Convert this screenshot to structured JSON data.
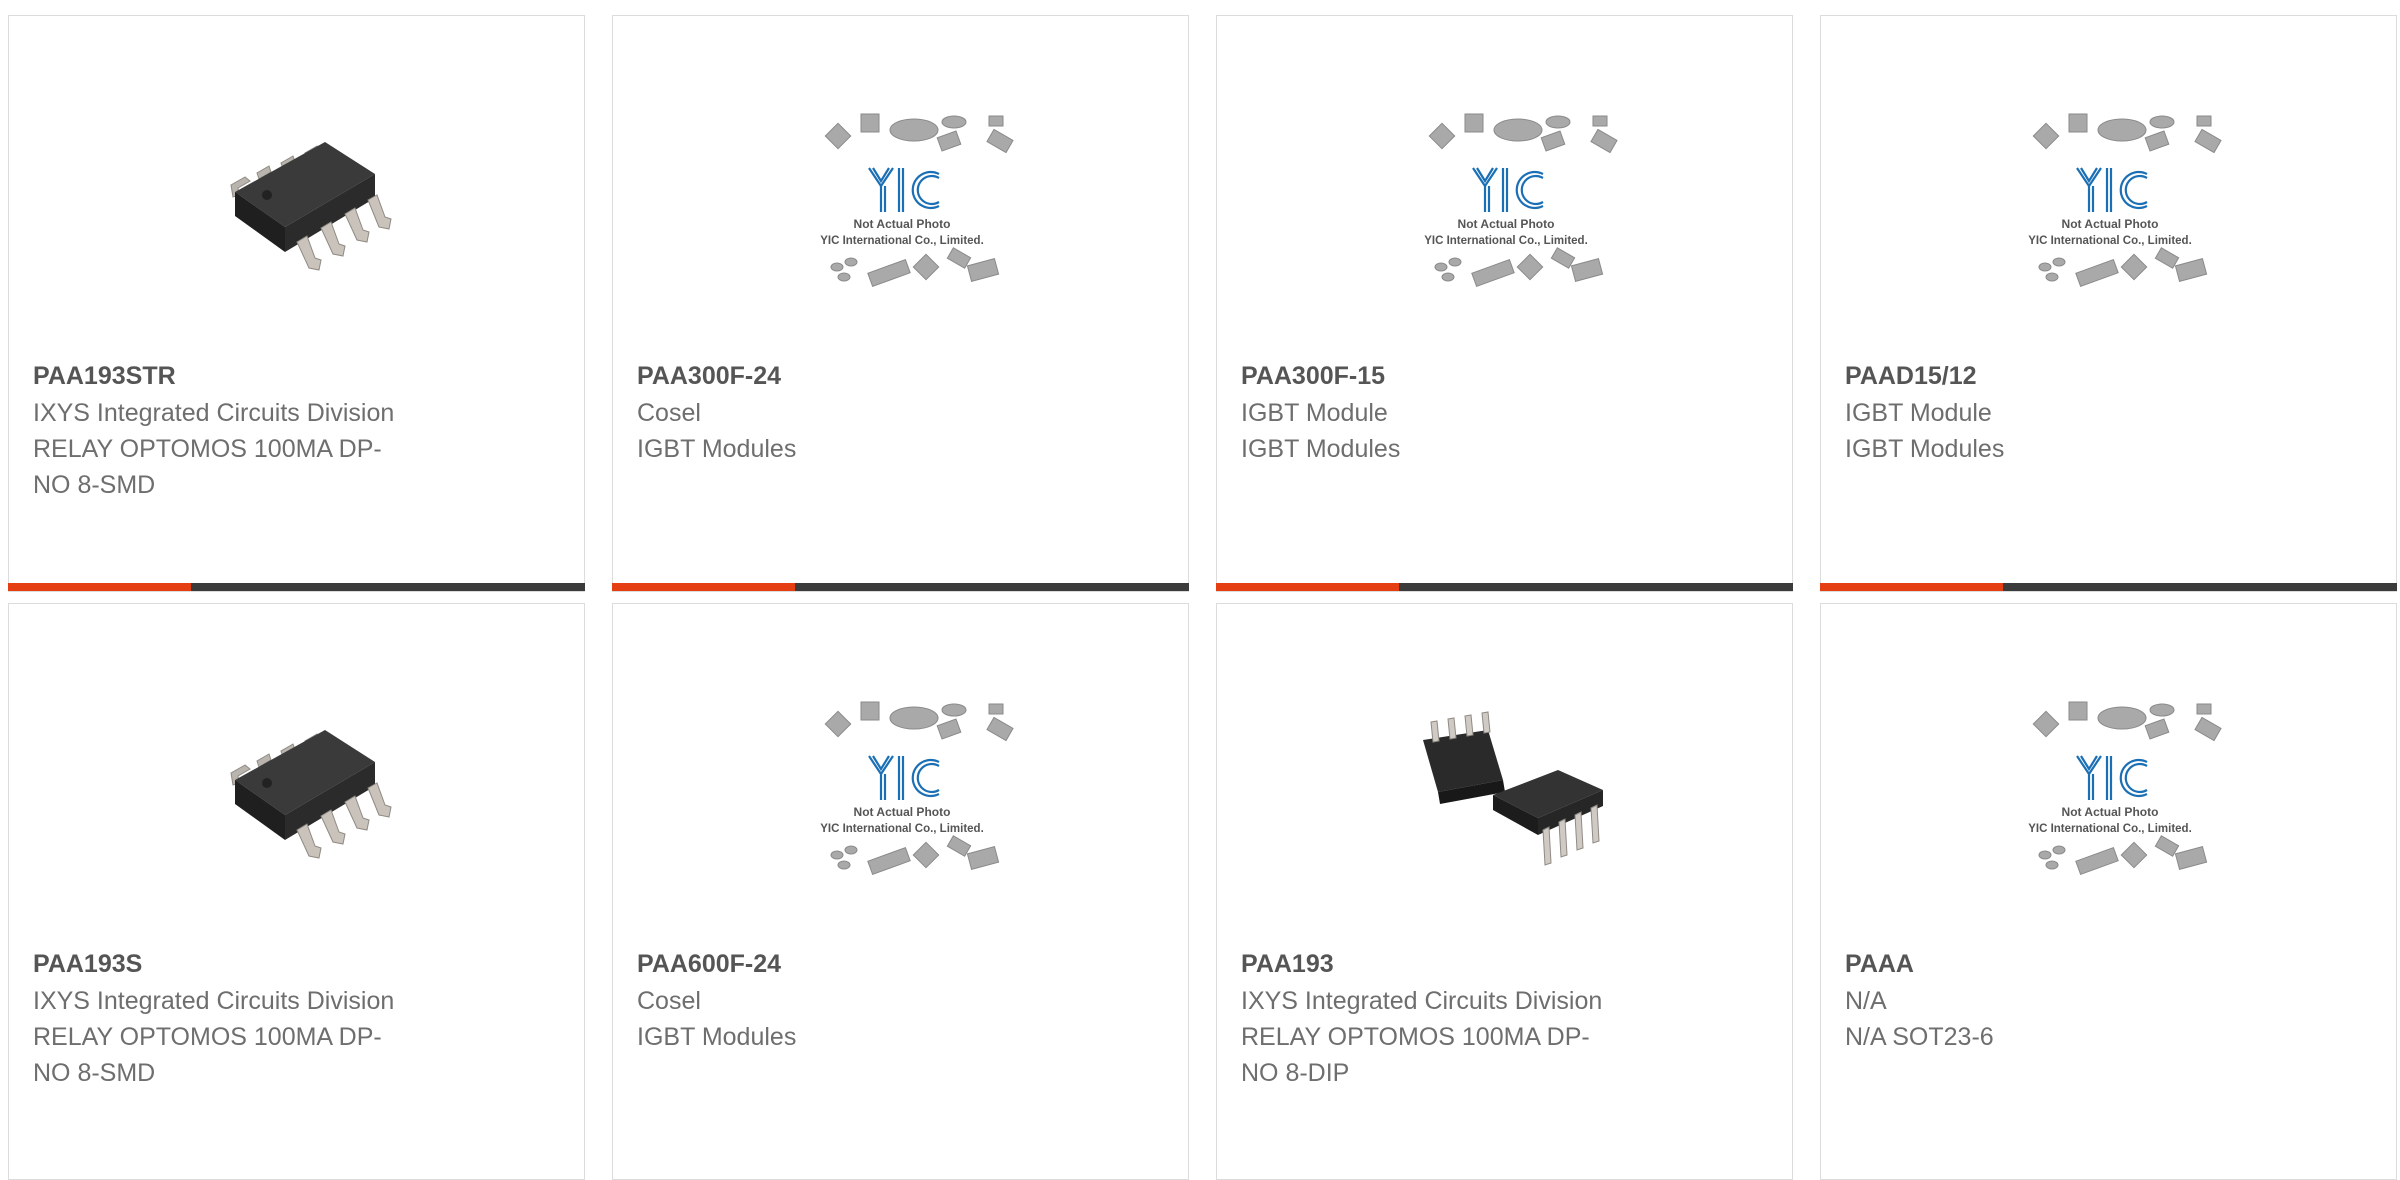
{
  "placeholder_caption": {
    "line1": "Not Actual Photo",
    "line2": "YIC International Co., Limited.",
    "logo": "YIC"
  },
  "accent_color": "#e43e12",
  "bar_color": "#3b3b3b",
  "products": [
    {
      "part": "PAA193STR",
      "line1": "IXYS Integrated Circuits Division",
      "line2": "RELAY OPTOMOS 100MA DP-",
      "line3": "NO 8-SMD",
      "image": "smd-8-chip-icon"
    },
    {
      "part": "PAA300F-24",
      "line1": "Cosel",
      "line2": "IGBT Modules",
      "line3": "",
      "image": "yic-placeholder"
    },
    {
      "part": "PAA300F-15",
      "line1": "IGBT Module",
      "line2": "IGBT Modules",
      "line3": "",
      "image": "yic-placeholder"
    },
    {
      "part": "PAAD15/12",
      "line1": "IGBT Module",
      "line2": "IGBT Modules",
      "line3": "",
      "image": "yic-placeholder"
    },
    {
      "part": "PAA193S",
      "line1": "IXYS Integrated Circuits Division",
      "line2": "RELAY OPTOMOS 100MA DP-",
      "line3": "NO 8-SMD",
      "image": "smd-8-chip-icon"
    },
    {
      "part": "PAA600F-24",
      "line1": "Cosel",
      "line2": "IGBT Modules",
      "line3": "",
      "image": "yic-placeholder"
    },
    {
      "part": "PAA193",
      "line1": "IXYS Integrated Circuits Division",
      "line2": "RELAY OPTOMOS 100MA DP-",
      "line3": "NO 8-DIP",
      "image": "dip-8-chip-icon"
    },
    {
      "part": "PAAA",
      "line1": "N/A",
      "line2": "N/A SOT23-6",
      "line3": "",
      "image": "yic-placeholder"
    }
  ]
}
